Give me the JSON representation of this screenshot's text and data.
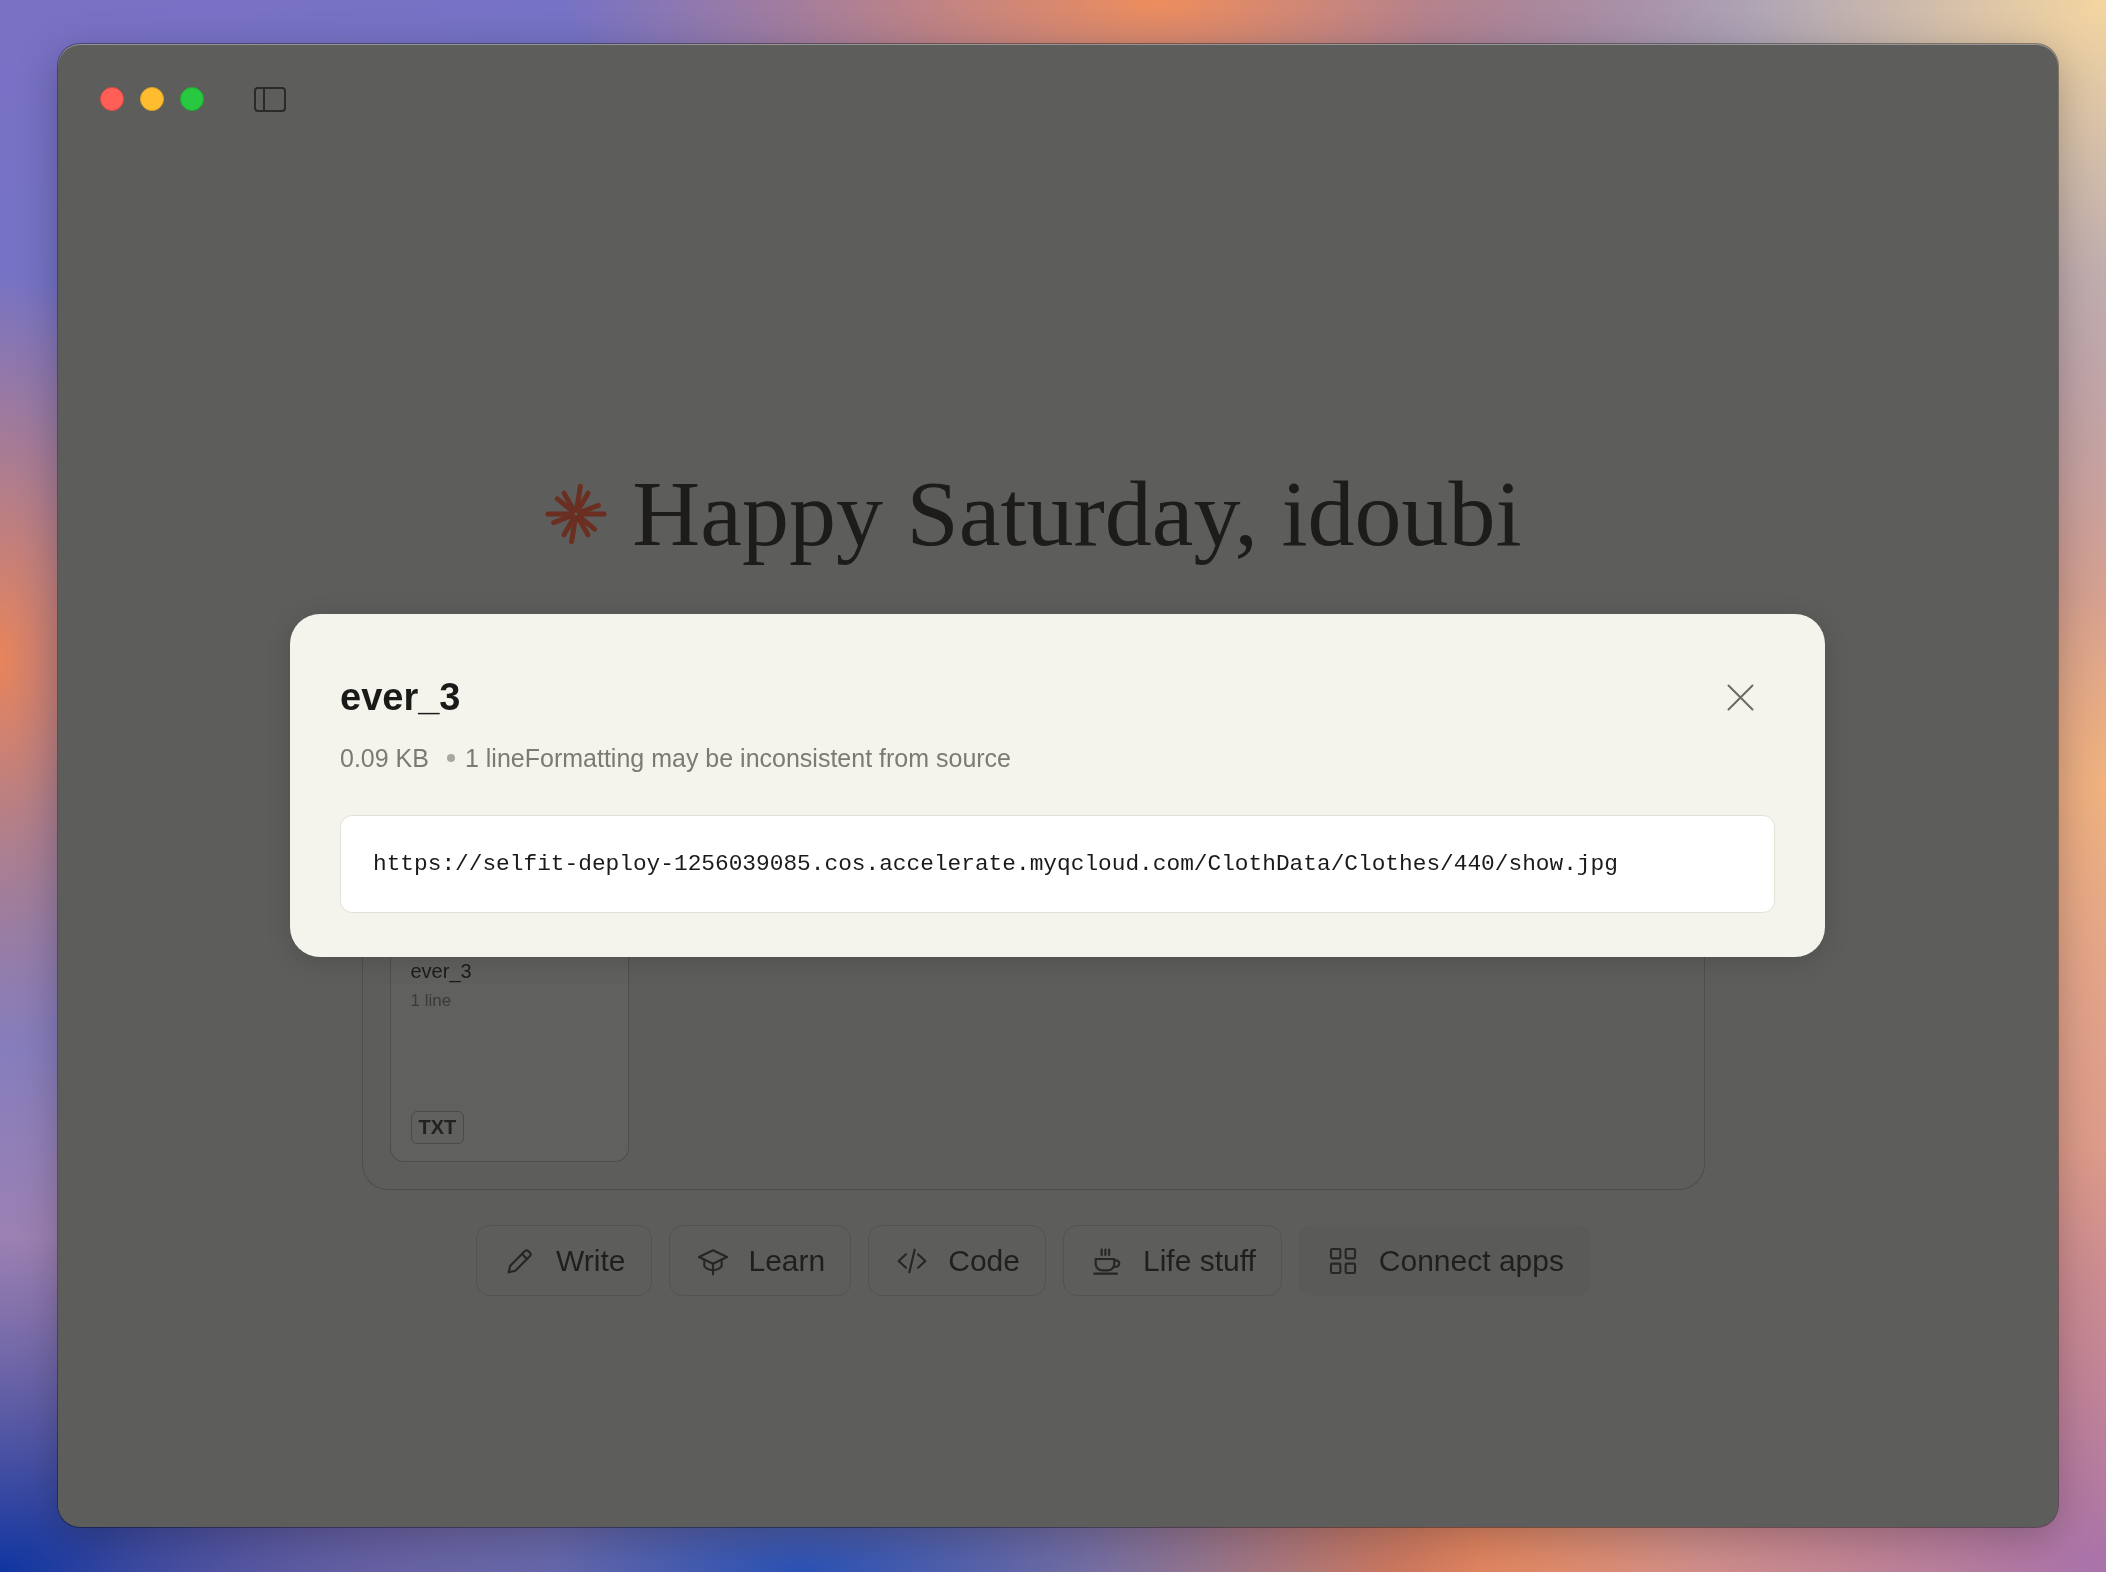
{
  "greeting": {
    "text": "Happy Saturday, idoubi"
  },
  "file_preview": {
    "title": "ever_3",
    "size": "0.09 KB",
    "details": "1 lineFormatting may be inconsistent from source",
    "content": "https://selfit-deploy-1256039085.cos.accelerate.myqcloud.com/ClothData/Clothes/440/show.jpg"
  },
  "attachments": [
    {
      "name": "ever_3",
      "lines": "1 line",
      "type": "TXT"
    }
  ],
  "suggestions": [
    {
      "label": "Write",
      "kind": "write"
    },
    {
      "label": "Learn",
      "kind": "learn"
    },
    {
      "label": "Code",
      "kind": "code"
    },
    {
      "label": "Life stuff",
      "kind": "life"
    },
    {
      "label": "Connect apps",
      "kind": "connect"
    }
  ]
}
